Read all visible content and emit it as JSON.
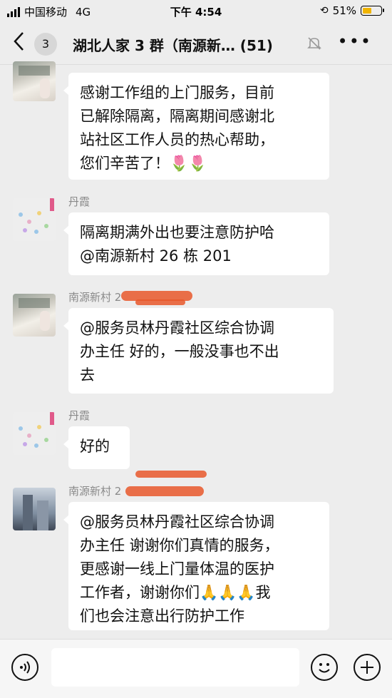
{
  "status_bar": {
    "carrier": "中国移动",
    "network": "4G",
    "time": "下午 4:54",
    "battery_pct": "51%",
    "battery_level": 0.51
  },
  "nav": {
    "back_icon": "chevron-left-icon",
    "unread_count": "3",
    "title": "湖北人家 3 群（南源新… (51)",
    "mute_icon": "bell-off-icon",
    "more_icon": "more-dots-icon"
  },
  "messages": [
    {
      "sender": "",
      "lines": [
        "感谢工作组的上门服务，目前",
        "已解除隔离，隔离期间感谢北",
        "站社区工作人员的热心帮助，",
        "您们辛苦了！🌷🌷"
      ]
    },
    {
      "sender": "丹霞",
      "lines": [
        "隔离期满外出也要注意防护哈",
        "@南源新村 26 栋 201"
      ]
    },
    {
      "sender": "南源新村 2",
      "lines": [
        "@服务员林丹霞社区综合协调",
        "办主任  好的，一般没事也不出",
        "去"
      ]
    },
    {
      "sender": "丹霞",
      "lines": [
        "好的"
      ]
    },
    {
      "sender": "南源新村 2",
      "lines": [
        "@服务员林丹霞社区综合协调",
        "办主任  谢谢你们真情的服务，",
        "更感谢一线上门量体温的医护",
        "工作者，谢谢你们🙏🙏🙏我",
        "们也会注意出行防护工作"
      ]
    }
  ],
  "input_bar": {
    "voice_icon": "voice-icon",
    "emoji_icon": "emoji-icon",
    "add_icon": "plus-circle-icon"
  }
}
